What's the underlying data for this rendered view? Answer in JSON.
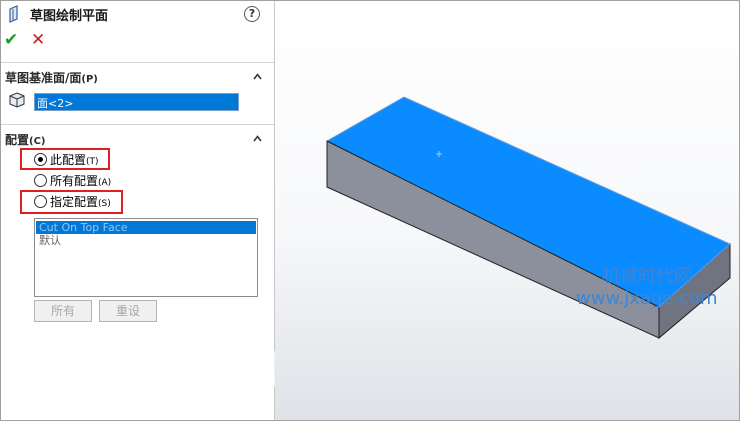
{
  "panel": {
    "title": "草图绘制平面",
    "help_icon": "?",
    "ok_icon": "✔",
    "cancel_icon": "✕"
  },
  "section_plane": {
    "header": "草图基准面/面",
    "accelerator": "(P)",
    "selected_face": "面<2>"
  },
  "section_config": {
    "header": "配置",
    "accelerator": "(C)",
    "options": [
      {
        "label": "此配置",
        "accelerator": "(T)",
        "selected": true
      },
      {
        "label": "所有配置",
        "accelerator": "(A)",
        "selected": false
      },
      {
        "label": "指定配置",
        "accelerator": "(S)",
        "selected": false
      }
    ],
    "list_items": [
      "Cut On Top Face",
      "默认"
    ],
    "buttons": {
      "all": "所有",
      "reset": "重设"
    }
  },
  "watermark": {
    "line1": "机械时代网",
    "line2": "www.jxage.com"
  },
  "colors": {
    "selected_face": "#0a8bff",
    "side_face": "#8e939f",
    "ok": "#1d9a2a",
    "cancel": "#d31b1b",
    "highlight_box": "#e02020"
  }
}
